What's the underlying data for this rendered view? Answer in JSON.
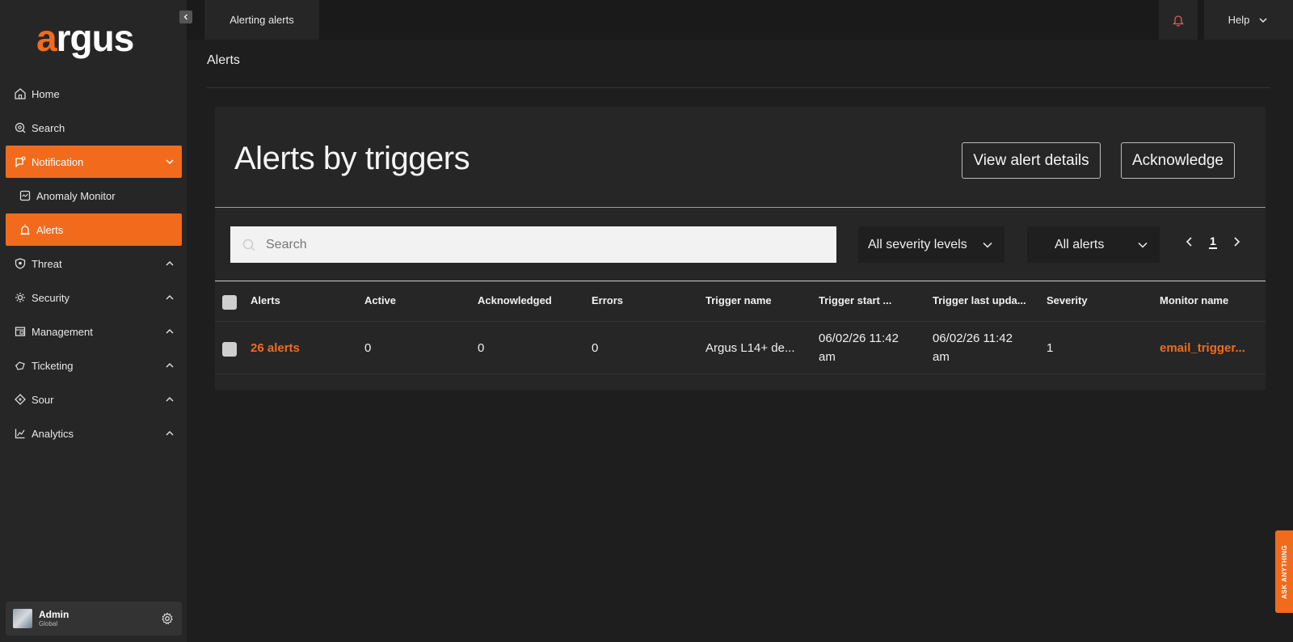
{
  "brand": {
    "logo_accent": "a",
    "logo_rest": "rgus",
    "accent_color": "#f26b1d"
  },
  "topbar": {
    "tab_label": "Alerting alerts",
    "help_label": "Help",
    "bell_icon": "bell-icon"
  },
  "sidebar": {
    "items": [
      {
        "label": "Home",
        "icon": "home-icon"
      },
      {
        "label": "Search",
        "icon": "search-icon"
      },
      {
        "label": "Notification",
        "icon": "notification-icon",
        "expanded": true
      },
      {
        "label": "Anomaly Monitor",
        "icon": "monitor-icon"
      },
      {
        "label": "Alerts",
        "icon": "alarm-icon",
        "selected": true
      },
      {
        "label": "Threat",
        "icon": "shield-icon"
      },
      {
        "label": "Security",
        "icon": "security-icon"
      },
      {
        "label": "Management",
        "icon": "management-icon"
      },
      {
        "label": "Ticketing",
        "icon": "ticket-icon"
      },
      {
        "label": "Sour",
        "icon": "source-icon"
      },
      {
        "label": "Analytics",
        "icon": "analytics-icon"
      }
    ],
    "user": {
      "name": "Admin",
      "role": "Global"
    }
  },
  "page": {
    "title": "Alerts"
  },
  "card": {
    "title": "Alerts by triggers",
    "view_button": "View alert details",
    "ack_button": "Acknowledge",
    "search_placeholder": "Search",
    "severity_filter": "All severity levels",
    "alerts_filter": "All alerts",
    "page_number": "1"
  },
  "table": {
    "headers": [
      "Alerts",
      "Active",
      "Acknowledged",
      "Errors",
      "Trigger name",
      "Trigger start ...",
      "Trigger last upda...",
      "Severity",
      "Monitor name"
    ],
    "rows": [
      {
        "alerts": "26 alerts",
        "active": "0",
        "acknowledged": "0",
        "errors": "0",
        "trigger_name": "Argus L14+ de...",
        "start_line1": "06/02/26 11:42",
        "start_line2": "am",
        "last_line1": "06/02/26 11:42",
        "last_line2": "am",
        "severity": "1",
        "monitor": "email_trigger..."
      }
    ]
  },
  "ask_widget": {
    "label": "ASK ANYTHING"
  }
}
